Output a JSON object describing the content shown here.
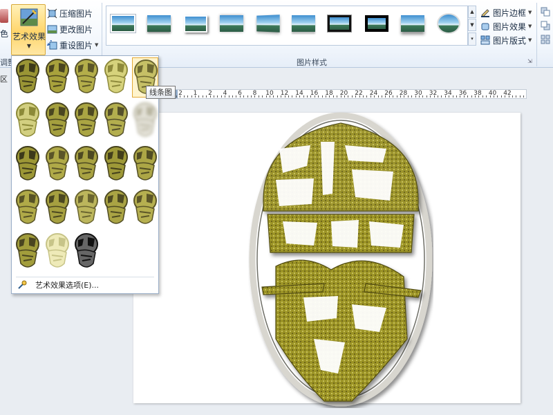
{
  "ribbon": {
    "adjust_group": {
      "partial_label": "色",
      "group_label": "调整"
    },
    "art_effects_button": {
      "label": "艺术效果"
    },
    "adjust_commands": [
      {
        "icon": "compress-icon",
        "label": "压缩图片"
      },
      {
        "icon": "change-picture-icon",
        "label": "更改图片"
      },
      {
        "icon": "reset-picture-icon",
        "label": "重设图片"
      }
    ],
    "picture_styles": {
      "group_label": "图片样式",
      "thumbnails": [
        "simple-frame-white",
        "soft-edge",
        "drop-shadow",
        "reflected",
        "perspective",
        "soft-shadow",
        "thick-black",
        "metal-frame",
        "reflected-rounded",
        "oval"
      ]
    },
    "picture_commands": [
      {
        "icon": "picture-border-icon",
        "label": "图片边框"
      },
      {
        "icon": "picture-effects-icon",
        "label": "图片效果"
      },
      {
        "icon": "picture-layout-icon",
        "label": "图片版式"
      }
    ]
  },
  "left_pane": {
    "partial_label": "区"
  },
  "ruler": {
    "labels": [
      "2",
      "1",
      "2",
      "4",
      "6",
      "8",
      "10",
      "12",
      "14",
      "16",
      "18",
      "20",
      "22",
      "24",
      "26",
      "28",
      "30",
      "32",
      "34",
      "36",
      "38",
      "40",
      "42"
    ]
  },
  "art_effects_gallery": {
    "rows": 5,
    "columns": 5,
    "selected_index": 4,
    "hovered_index": 4,
    "tooltip": "线条图",
    "options_label": "艺术效果选项(E)..."
  },
  "colors": {
    "accent_orange": "#ffd56b",
    "ribbon_blue": "#1e395b",
    "gold": "#a8a030"
  }
}
